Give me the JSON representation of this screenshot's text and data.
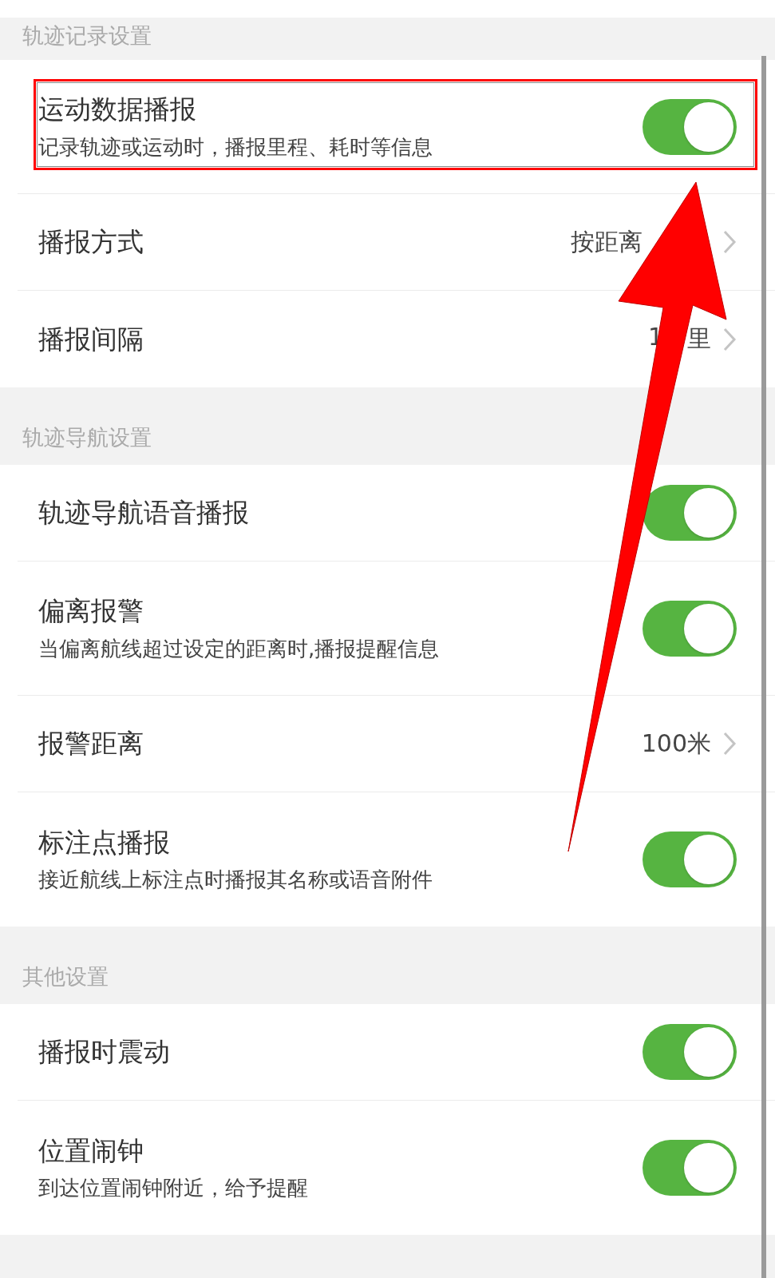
{
  "sections": [
    {
      "header": "轨迹记录设置",
      "rows": [
        {
          "kind": "toggle",
          "title": "运动数据播报",
          "subtitle": "记录轨迹或运动时，播报里程、耗时等信息",
          "on": true,
          "highlighted": true
        },
        {
          "kind": "link",
          "title": "播报方式",
          "value_parts": [
            "按距离"
          ],
          "covered": true
        },
        {
          "kind": "link",
          "title": "播报间隔",
          "value_parts": [
            "1",
            "里"
          ],
          "covered": true
        }
      ]
    },
    {
      "header": "轨迹导航设置",
      "rows": [
        {
          "kind": "toggle",
          "title": "轨迹导航语音播报",
          "on": true
        },
        {
          "kind": "toggle",
          "title": "偏离报警",
          "subtitle": "当偏离航线超过设定的距离时,播报提醒信息",
          "on": true
        },
        {
          "kind": "link",
          "title": "报警距离",
          "value_parts": [
            "100米"
          ]
        },
        {
          "kind": "toggle",
          "title": "标注点播报",
          "subtitle": "接近航线上标注点时播报其名称或语音附件",
          "on": true
        }
      ]
    },
    {
      "header": "其他设置",
      "rows": [
        {
          "kind": "toggle",
          "title": "播报时震动",
          "on": true
        },
        {
          "kind": "toggle",
          "title": "位置闹钟",
          "subtitle": "到达位置闹钟附近，给予提醒",
          "on": true
        }
      ]
    }
  ]
}
